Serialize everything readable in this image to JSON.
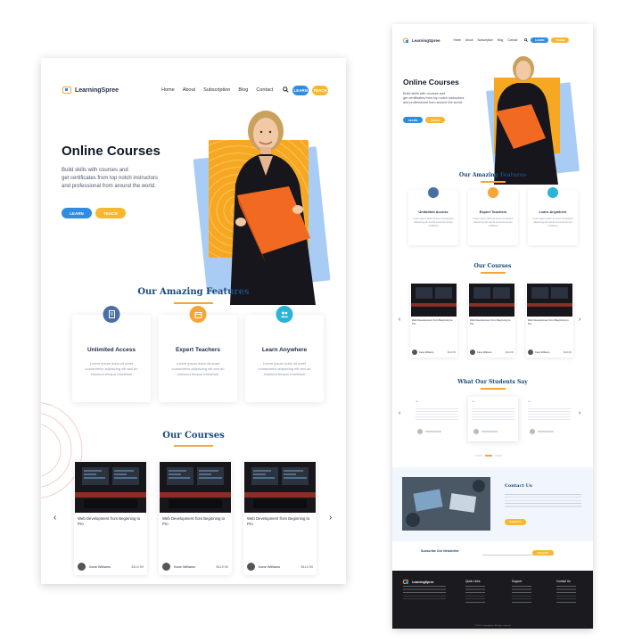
{
  "brand": {
    "name": "LearningSpree",
    "accent_blue": "#2f8ce0",
    "accent_orange": "#f7b731",
    "heading_blue": "#1a4a7a"
  },
  "nav": {
    "links": [
      "Home",
      "About",
      "Subscription",
      "Blog",
      "Contact"
    ],
    "search_icon": "search-icon",
    "learn_label": "LEARN",
    "teach_label": "TEACH"
  },
  "hero": {
    "title": "Online Courses",
    "line1": "Build skills with courses and",
    "line2": "get certificates from top notch instructors",
    "line3": "and professional from around the world.",
    "learn_label": "LEARN",
    "teach_label": "TEACH"
  },
  "features": {
    "title": "Our Amazing Features",
    "items": [
      {
        "title": "Unlimited Access",
        "icon": "document-icon",
        "color": "#4a6fa5",
        "text": "Lorem ipsum dolor sit amet consectetur adipiscing elit sed do eiusmod tempor incididunt"
      },
      {
        "title": "Expert Teachers",
        "icon": "calendar-icon",
        "color": "#f4a637",
        "text": "Lorem ipsum dolor sit amet consectetur adipiscing elit sed do eiusmod tempor incididunt"
      },
      {
        "title": "Learn Anywhere",
        "icon": "users-icon",
        "color": "#2bb3d9",
        "text": "Lorem ipsum dolor sit amet consectetur adipiscing elit sed do eiusmod tempor incididunt"
      }
    ]
  },
  "courses": {
    "title": "Our Courses",
    "items": [
      {
        "title": "Web Development from Beginning to Pro",
        "author": "Kane Williams",
        "price": "$119.99"
      },
      {
        "title": "Web Development from Beginning to Pro",
        "author": "Kane Williams",
        "price": "$119.99"
      },
      {
        "title": "Web Development from Beginning to Pro",
        "author": "Kane Williams",
        "price": "$119.99"
      }
    ],
    "prev_icon": "chevron-left-icon",
    "next_icon": "chevron-right-icon"
  },
  "testimonials": {
    "title": "What Our Students Say"
  },
  "contact": {
    "title": "Contact Us",
    "button_label": "Contact Us"
  },
  "newsletter": {
    "title": "Subscribe Our Newsletter",
    "button_label": "Subscribe"
  },
  "footer": {
    "columns": [
      "Quick Links",
      "Support",
      "Contact Us"
    ],
    "copyright": "© 2022 LearningSpree. All rights reserved."
  }
}
